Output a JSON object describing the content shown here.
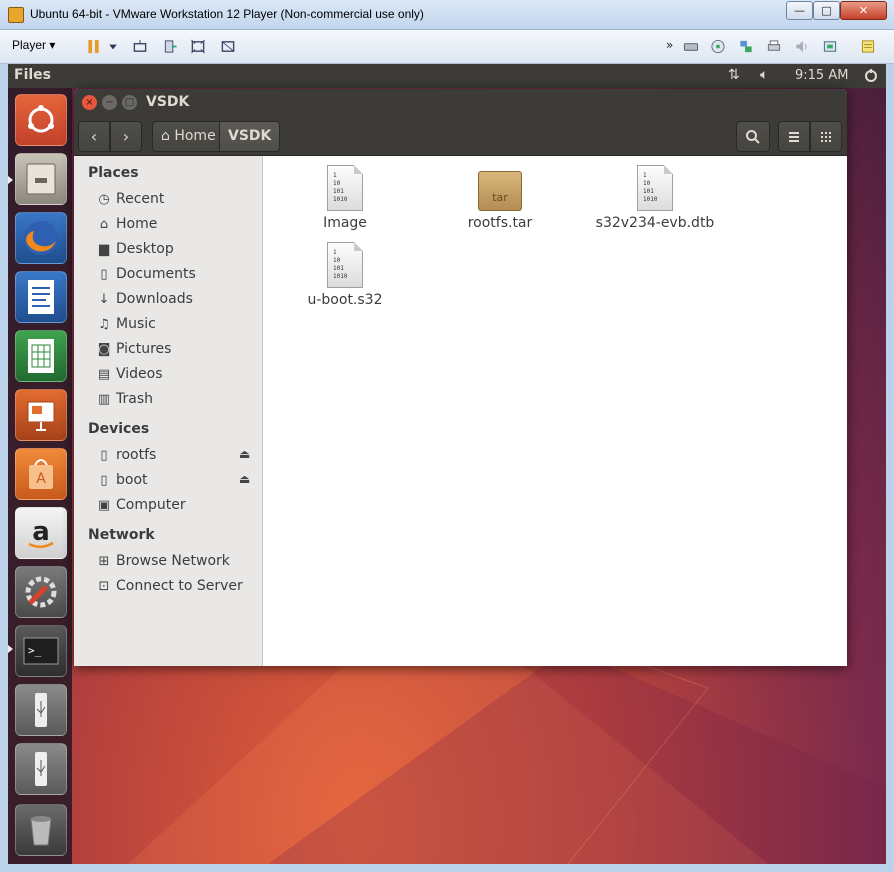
{
  "vm": {
    "title": "Ubuntu 64-bit - VMware Workstation 12 Player (Non-commercial use only)",
    "player_label": "Player ▾",
    "window_buttons": {
      "minimize": "—",
      "maximize": "□",
      "close": "✕"
    }
  },
  "panel": {
    "app_name": "Files",
    "clock": "9:15 AM"
  },
  "launcher": {
    "items": [
      "ubuntu-dash",
      "files",
      "firefox",
      "libreoffice-writer",
      "libreoffice-calc",
      "libreoffice-impress",
      "software-center",
      "amazon",
      "system-settings",
      "terminal",
      "usb-drive",
      "usb-drive",
      "trash"
    ]
  },
  "window": {
    "title": "VSDK",
    "breadcrumb": {
      "home": "Home",
      "current": "VSDK"
    }
  },
  "sidebar": {
    "places_heading": "Places",
    "places": [
      {
        "label": "Recent",
        "icon": "clock-icon"
      },
      {
        "label": "Home",
        "icon": "home-icon"
      },
      {
        "label": "Desktop",
        "icon": "folder-icon"
      },
      {
        "label": "Documents",
        "icon": "document-icon"
      },
      {
        "label": "Downloads",
        "icon": "download-icon"
      },
      {
        "label": "Music",
        "icon": "music-icon"
      },
      {
        "label": "Pictures",
        "icon": "camera-icon"
      },
      {
        "label": "Videos",
        "icon": "film-icon"
      },
      {
        "label": "Trash",
        "icon": "trash-icon"
      }
    ],
    "devices_heading": "Devices",
    "devices": [
      {
        "label": "rootfs",
        "icon": "drive-icon"
      },
      {
        "label": "boot",
        "icon": "drive-icon"
      },
      {
        "label": "Computer",
        "icon": "computer-icon"
      }
    ],
    "network_heading": "Network",
    "network": [
      {
        "label": "Browse Network",
        "icon": "network-icon"
      },
      {
        "label": "Connect to Server",
        "icon": "server-icon"
      }
    ]
  },
  "files": [
    {
      "name": "Image",
      "type": "binary"
    },
    {
      "name": "rootfs.tar",
      "type": "tar",
      "icon_label": "tar"
    },
    {
      "name": "s32v234-evb.dtb",
      "type": "binary"
    },
    {
      "name": "u-boot.s32",
      "type": "binary"
    }
  ],
  "binary_icon_text": "1\n10\n101\n1010"
}
